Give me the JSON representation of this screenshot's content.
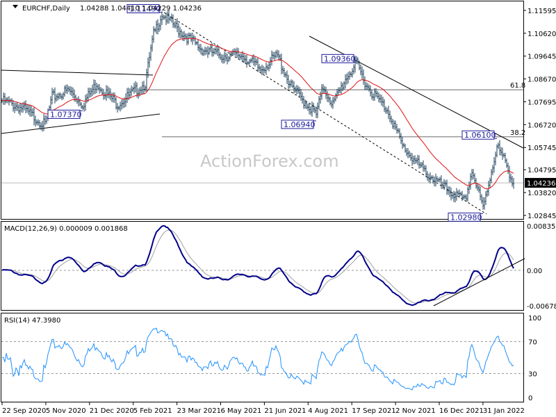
{
  "header": {
    "symbol": "EURCHF,Daily",
    "ohlc": "1.04288 1.04410 1.04229 1.04236"
  },
  "watermark": "ActionForex.com",
  "chart_data": [
    {
      "type": "ohlc",
      "title": "EURCHF,Daily",
      "open": 1.04288,
      "high": 1.0441,
      "low": 1.04229,
      "close": 1.04236,
      "ylim": [
        1.02845,
        1.11595
      ],
      "y_ticks": [
        "1.11595",
        "1.10620",
        "1.09645",
        "1.08670",
        "1.07695",
        "1.06720",
        "1.05745",
        "1.04795",
        "1.03820",
        "1.02845"
      ],
      "current_price": "1.04236",
      "close_keypoints": [
        [
          0,
          1.0774
        ],
        [
          14,
          1.0744
        ],
        [
          31,
          1.067
        ],
        [
          36,
          1.0789
        ],
        [
          48,
          1.0818
        ],
        [
          58,
          1.0759
        ],
        [
          68,
          1.0848
        ],
        [
          83,
          1.0759
        ],
        [
          93,
          1.0804
        ],
        [
          103,
          1.0848
        ],
        [
          109,
          1.1056
        ],
        [
          115,
          1.1145
        ],
        [
          128,
          1.1071
        ],
        [
          143,
          1.0996
        ],
        [
          158,
          1.0967
        ],
        [
          173,
          1.0967
        ],
        [
          186,
          1.0907
        ],
        [
          198,
          1.0967
        ],
        [
          208,
          1.0833
        ],
        [
          226,
          1.0715
        ],
        [
          231,
          1.0833
        ],
        [
          238,
          1.0759
        ],
        [
          248,
          1.0878
        ],
        [
          255,
          1.093
        ],
        [
          263,
          1.0833
        ],
        [
          278,
          1.0729
        ],
        [
          288,
          1.0581
        ],
        [
          303,
          1.0477
        ],
        [
          318,
          1.0403
        ],
        [
          333,
          1.0344
        ],
        [
          338,
          1.0477
        ],
        [
          346,
          1.0314
        ],
        [
          356,
          1.0581
        ],
        [
          361,
          1.0522
        ],
        [
          368,
          1.0424
        ]
      ],
      "annotations": [
        {
          "text": "1.11490",
          "bar": 115,
          "price": 1.1149
        },
        {
          "text": "1.07370",
          "bar": 58,
          "price": 1.0737
        },
        {
          "text": "1.09360",
          "bar": 255,
          "price": 1.0936
        },
        {
          "text": "1.06940",
          "bar": 226,
          "price": 1.0694
        },
        {
          "text": "1.06100",
          "bar": 356,
          "price": 1.061
        },
        {
          "text": "1.02980",
          "bar": 346,
          "price": 1.0298
        }
      ],
      "fib_levels": [
        {
          "text": "61.8",
          "price": 1.0821
        },
        {
          "text": "38.2",
          "price": 1.062
        }
      ],
      "moving_average": "EMA 55 (red)"
    },
    {
      "type": "line",
      "title": "MACD(12,26,9) 0.000009 0.001868",
      "y_ticks": [
        "0.008353",
        "0.00",
        "-0.006788"
      ],
      "ylim": [
        -0.006788,
        0.008353
      ]
    },
    {
      "type": "line",
      "title": "RSI(14) 47.3980",
      "y_ticks": [
        "100",
        "70",
        "30",
        "0"
      ],
      "ylim": [
        0,
        100
      ],
      "levels": [
        70,
        30
      ]
    }
  ],
  "x_ticks": [
    "22 Sep 2020",
    "5 Nov 2020",
    "21 Dec 2020",
    "5 Feb 2021",
    "23 Mar 2021",
    "6 May 2021",
    "21 Jun 2021",
    "4 Aug 2021",
    "17 Sep 2021",
    "2 Nov 2021",
    "16 Dec 2021",
    "31 Jan 2022"
  ],
  "colors": {
    "bars": "#1c3f5a",
    "ma": "#e01010",
    "macd": "#00008b",
    "signal": "#a0a0a0",
    "rsi": "#1e90ff"
  }
}
